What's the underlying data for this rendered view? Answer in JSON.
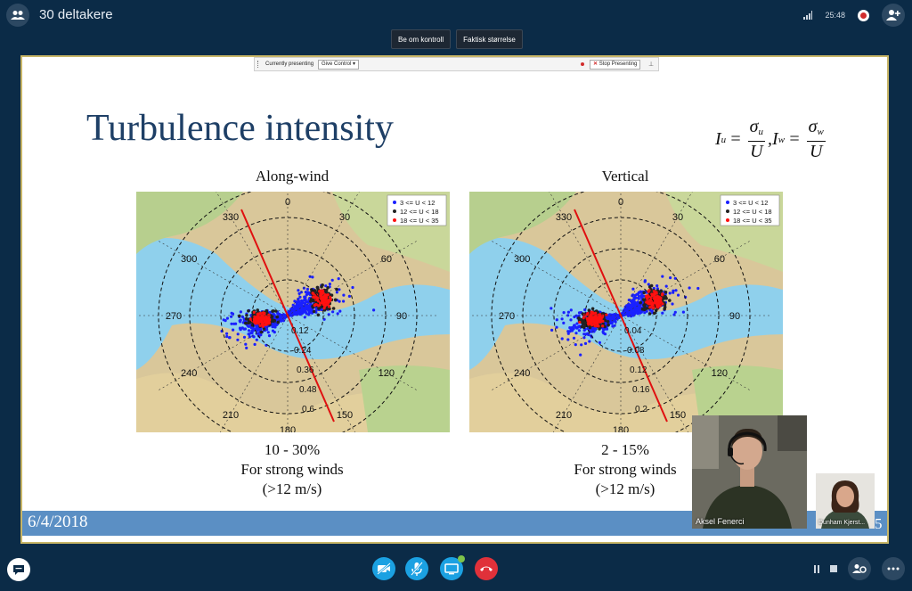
{
  "header": {
    "title": "30 deltakere",
    "clock": "25:48"
  },
  "share_controls": {
    "request_control": "Be om kontroll",
    "actual_size": "Faktisk størrelse"
  },
  "present_bar": {
    "currently": "Currently presenting",
    "give_control": "Give Control ▾",
    "stop": "Stop Presenting"
  },
  "slide": {
    "title": "Turbulence intensity",
    "formula": {
      "I": "I",
      "u": "u",
      "w": "w",
      "sigma": "σ",
      "U": "U",
      "eq": "=",
      "comma": ","
    },
    "left": {
      "label": "Along-wind",
      "caption_1": "10 - 30%",
      "caption_2": "For strong winds",
      "caption_3": "(>12 m/s)",
      "radial_ticks": [
        "0.12",
        "0.24",
        "0.36",
        "0.48",
        "0.6"
      ]
    },
    "right": {
      "label": "Vertical",
      "caption_1": "2 - 15%",
      "caption_2": "For strong winds",
      "caption_3": "(>12 m/s)",
      "radial_ticks": [
        "0.04",
        "0.08",
        "0.12",
        "0.16",
        "0.2"
      ]
    },
    "compass": [
      "0",
      "30",
      "60",
      "90",
      "120",
      "150",
      "180",
      "210",
      "240",
      "270",
      "300",
      "330"
    ],
    "legend": [
      "3 <= U < 12",
      "12 <= U < 18",
      "18 <= U < 35"
    ],
    "date": "6/4/2018",
    "page": "5"
  },
  "videos": {
    "main_name": "Aksel Fenerci",
    "small_name": "Dunham Kjerst..."
  },
  "colors": {
    "accent": "#1ba1e2",
    "end_call": "#e0313a",
    "title": "#1e3f66",
    "band": "#5b8fc4"
  }
}
